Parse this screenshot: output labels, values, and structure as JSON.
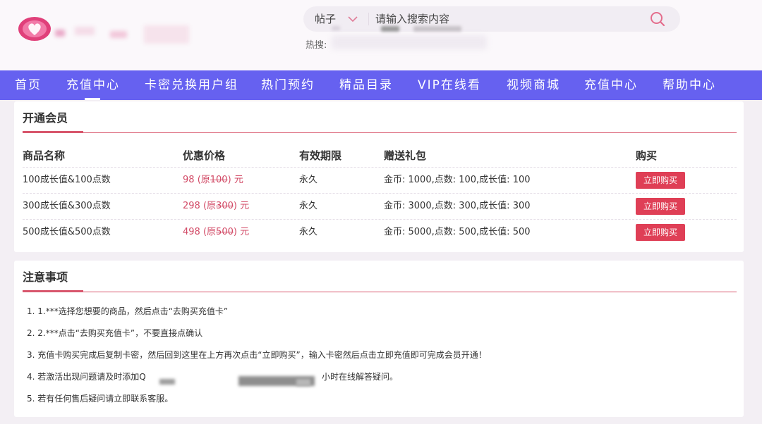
{
  "header": {
    "search": {
      "type_label": "帖子",
      "placeholder": "请输入搜索内容",
      "hot_label": "热搜:"
    }
  },
  "nav": {
    "items": [
      "首页",
      "充值中心",
      "卡密兑换用户组",
      "热门预约",
      "精品目录",
      "VIP在线看",
      "视频商城",
      "充值中心",
      "帮助中心"
    ],
    "active_index": 1
  },
  "membership": {
    "title": "开通会员",
    "columns": [
      "商品名称",
      "优惠价格",
      "有效期限",
      "赠送礼包",
      "购买"
    ],
    "rows": [
      {
        "name": "100成长值&100点数",
        "price": "98",
        "orig_prefix": "(原",
        "orig": "100",
        "orig_suffix": ")",
        "unit": "元",
        "validity": "永久",
        "gift": "金币: 1000,点数: 100,成长值: 100",
        "button": "立即购买"
      },
      {
        "name": "300成长值&300点数",
        "price": "298",
        "orig_prefix": "(原",
        "orig": "300",
        "orig_suffix": ")",
        "unit": "元",
        "validity": "永久",
        "gift": "金币: 3000,点数: 300,成长值: 300",
        "button": "立即购买"
      },
      {
        "name": "500成长值&500点数",
        "price": "498",
        "orig_prefix": "(原",
        "orig": "500",
        "orig_suffix": ")",
        "unit": "元",
        "validity": "永久",
        "gift": "金币: 5000,点数: 500,成长值: 500",
        "button": "立即购买"
      }
    ]
  },
  "notes": {
    "title": "注意事项",
    "items": [
      "1. 1.***选择您想要的商品，然后点击“去购买充值卡”",
      "2. 2.***点击“去购买充值卡”，不要直接点确认",
      "3. 充值卡购买完成后复制卡密，然后回到这里在上方再次点击“立即购买”，输入卡密然后点击立即充值即可完成会员开通！",
      "4. 若激活出现问题请及时添加Q",
      "5. 若有任何售后疑问请立即联系客服。"
    ],
    "item4_tail": "小时在线解答疑问。"
  },
  "colors": {
    "nav_bg": "#6661f0",
    "accent": "#d8566c",
    "buy_button": "#df3f56",
    "price": "#d24a66"
  }
}
